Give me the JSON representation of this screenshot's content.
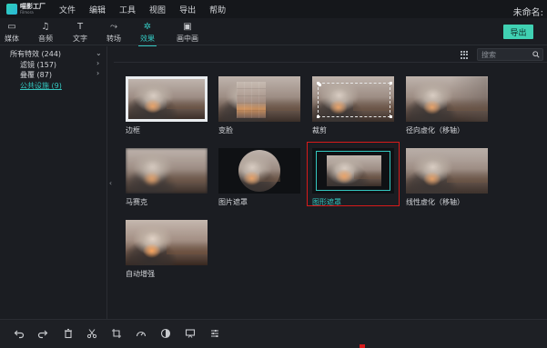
{
  "app": {
    "logo_line1": "喵影工厂",
    "logo_line2": "Filmora",
    "document_name": "未命名:"
  },
  "menu": [
    "文件",
    "编辑",
    "工具",
    "视图",
    "导出",
    "帮助"
  ],
  "toolbar": {
    "tabs": [
      {
        "label": "媒体",
        "icon": "folder-icon",
        "glyph": "▭"
      },
      {
        "label": "音频",
        "icon": "music-note-icon",
        "glyph": "♫"
      },
      {
        "label": "文字",
        "icon": "text-icon",
        "glyph": "T"
      },
      {
        "label": "转场",
        "icon": "transition-icon",
        "glyph": "⤳"
      },
      {
        "label": "效果",
        "icon": "effects-icon",
        "glyph": "✲"
      },
      {
        "label": "画中画",
        "icon": "picture-in-picture-icon",
        "glyph": "▣"
      }
    ],
    "active_tab": "效果",
    "export_label": "导出"
  },
  "sidebar": {
    "items": [
      {
        "label": "所有特效 (244)",
        "expanded": true
      },
      {
        "label": "滤镜 (157)",
        "arrow": "›"
      },
      {
        "label": "叠覆 (87)",
        "arrow": "›"
      },
      {
        "label": "公共设施 (9)",
        "selected": true
      }
    ],
    "collapse_glyph": "‹"
  },
  "search": {
    "placeholder": "搜索",
    "value": ""
  },
  "effects": [
    {
      "label": "边框",
      "style": "fx-border"
    },
    {
      "label": "变脸",
      "style": "fx-mosaic"
    },
    {
      "label": "裁剪",
      "style": "fx-crop"
    },
    {
      "label": "径向虚化（移轴）",
      "style": "fx-vignette"
    },
    {
      "label": "马赛克",
      "style": "fx-blur"
    },
    {
      "label": "图片遮罩",
      "style": "fx-image-mask"
    },
    {
      "label": "图形遮罩",
      "style": "fx-shape-mask",
      "selected": true
    },
    {
      "label": "线性虚化（移轴）",
      "style": "fx-tilt"
    },
    {
      "label": "自动增强",
      "style": "fx-auto"
    }
  ],
  "bottom_tools": [
    {
      "name": "undo-icon"
    },
    {
      "name": "redo-icon"
    },
    {
      "name": "delete-icon"
    },
    {
      "name": "cut-icon"
    },
    {
      "name": "crop-icon"
    },
    {
      "name": "speed-icon"
    },
    {
      "name": "color-icon"
    },
    {
      "name": "green-screen-icon"
    },
    {
      "name": "audio-adjust-icon"
    }
  ],
  "colors": {
    "accent": "#34c7c0",
    "export_button": "#40d1b3",
    "selection_frame": "#d71a1a",
    "background": "#1b1d22"
  }
}
